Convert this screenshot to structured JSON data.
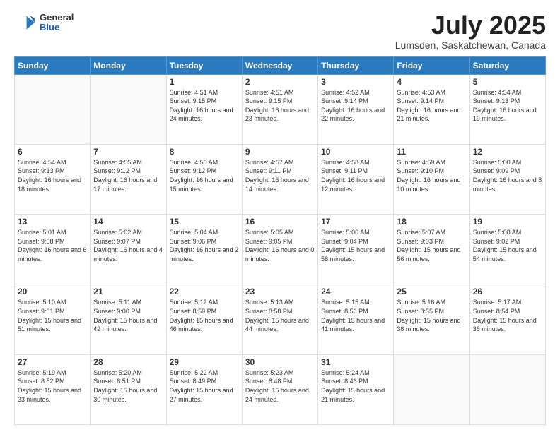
{
  "header": {
    "logo": {
      "general": "General",
      "blue": "Blue"
    },
    "title": "July 2025",
    "subtitle": "Lumsden, Saskatchewan, Canada"
  },
  "weekdays": [
    "Sunday",
    "Monday",
    "Tuesday",
    "Wednesday",
    "Thursday",
    "Friday",
    "Saturday"
  ],
  "weeks": [
    [
      {
        "day": "",
        "info": ""
      },
      {
        "day": "",
        "info": ""
      },
      {
        "day": "1",
        "info": "Sunrise: 4:51 AM\nSunset: 9:15 PM\nDaylight: 16 hours and 24 minutes."
      },
      {
        "day": "2",
        "info": "Sunrise: 4:51 AM\nSunset: 9:15 PM\nDaylight: 16 hours and 23 minutes."
      },
      {
        "day": "3",
        "info": "Sunrise: 4:52 AM\nSunset: 9:14 PM\nDaylight: 16 hours and 22 minutes."
      },
      {
        "day": "4",
        "info": "Sunrise: 4:53 AM\nSunset: 9:14 PM\nDaylight: 16 hours and 21 minutes."
      },
      {
        "day": "5",
        "info": "Sunrise: 4:54 AM\nSunset: 9:13 PM\nDaylight: 16 hours and 19 minutes."
      }
    ],
    [
      {
        "day": "6",
        "info": "Sunrise: 4:54 AM\nSunset: 9:13 PM\nDaylight: 16 hours and 18 minutes."
      },
      {
        "day": "7",
        "info": "Sunrise: 4:55 AM\nSunset: 9:12 PM\nDaylight: 16 hours and 17 minutes."
      },
      {
        "day": "8",
        "info": "Sunrise: 4:56 AM\nSunset: 9:12 PM\nDaylight: 16 hours and 15 minutes."
      },
      {
        "day": "9",
        "info": "Sunrise: 4:57 AM\nSunset: 9:11 PM\nDaylight: 16 hours and 14 minutes."
      },
      {
        "day": "10",
        "info": "Sunrise: 4:58 AM\nSunset: 9:11 PM\nDaylight: 16 hours and 12 minutes."
      },
      {
        "day": "11",
        "info": "Sunrise: 4:59 AM\nSunset: 9:10 PM\nDaylight: 16 hours and 10 minutes."
      },
      {
        "day": "12",
        "info": "Sunrise: 5:00 AM\nSunset: 9:09 PM\nDaylight: 16 hours and 8 minutes."
      }
    ],
    [
      {
        "day": "13",
        "info": "Sunrise: 5:01 AM\nSunset: 9:08 PM\nDaylight: 16 hours and 6 minutes."
      },
      {
        "day": "14",
        "info": "Sunrise: 5:02 AM\nSunset: 9:07 PM\nDaylight: 16 hours and 4 minutes."
      },
      {
        "day": "15",
        "info": "Sunrise: 5:04 AM\nSunset: 9:06 PM\nDaylight: 16 hours and 2 minutes."
      },
      {
        "day": "16",
        "info": "Sunrise: 5:05 AM\nSunset: 9:05 PM\nDaylight: 16 hours and 0 minutes."
      },
      {
        "day": "17",
        "info": "Sunrise: 5:06 AM\nSunset: 9:04 PM\nDaylight: 15 hours and 58 minutes."
      },
      {
        "day": "18",
        "info": "Sunrise: 5:07 AM\nSunset: 9:03 PM\nDaylight: 15 hours and 56 minutes."
      },
      {
        "day": "19",
        "info": "Sunrise: 5:08 AM\nSunset: 9:02 PM\nDaylight: 15 hours and 54 minutes."
      }
    ],
    [
      {
        "day": "20",
        "info": "Sunrise: 5:10 AM\nSunset: 9:01 PM\nDaylight: 15 hours and 51 minutes."
      },
      {
        "day": "21",
        "info": "Sunrise: 5:11 AM\nSunset: 9:00 PM\nDaylight: 15 hours and 49 minutes."
      },
      {
        "day": "22",
        "info": "Sunrise: 5:12 AM\nSunset: 8:59 PM\nDaylight: 15 hours and 46 minutes."
      },
      {
        "day": "23",
        "info": "Sunrise: 5:13 AM\nSunset: 8:58 PM\nDaylight: 15 hours and 44 minutes."
      },
      {
        "day": "24",
        "info": "Sunrise: 5:15 AM\nSunset: 8:56 PM\nDaylight: 15 hours and 41 minutes."
      },
      {
        "day": "25",
        "info": "Sunrise: 5:16 AM\nSunset: 8:55 PM\nDaylight: 15 hours and 38 minutes."
      },
      {
        "day": "26",
        "info": "Sunrise: 5:17 AM\nSunset: 8:54 PM\nDaylight: 15 hours and 36 minutes."
      }
    ],
    [
      {
        "day": "27",
        "info": "Sunrise: 5:19 AM\nSunset: 8:52 PM\nDaylight: 15 hours and 33 minutes."
      },
      {
        "day": "28",
        "info": "Sunrise: 5:20 AM\nSunset: 8:51 PM\nDaylight: 15 hours and 30 minutes."
      },
      {
        "day": "29",
        "info": "Sunrise: 5:22 AM\nSunset: 8:49 PM\nDaylight: 15 hours and 27 minutes."
      },
      {
        "day": "30",
        "info": "Sunrise: 5:23 AM\nSunset: 8:48 PM\nDaylight: 15 hours and 24 minutes."
      },
      {
        "day": "31",
        "info": "Sunrise: 5:24 AM\nSunset: 8:46 PM\nDaylight: 15 hours and 21 minutes."
      },
      {
        "day": "",
        "info": ""
      },
      {
        "day": "",
        "info": ""
      }
    ]
  ]
}
